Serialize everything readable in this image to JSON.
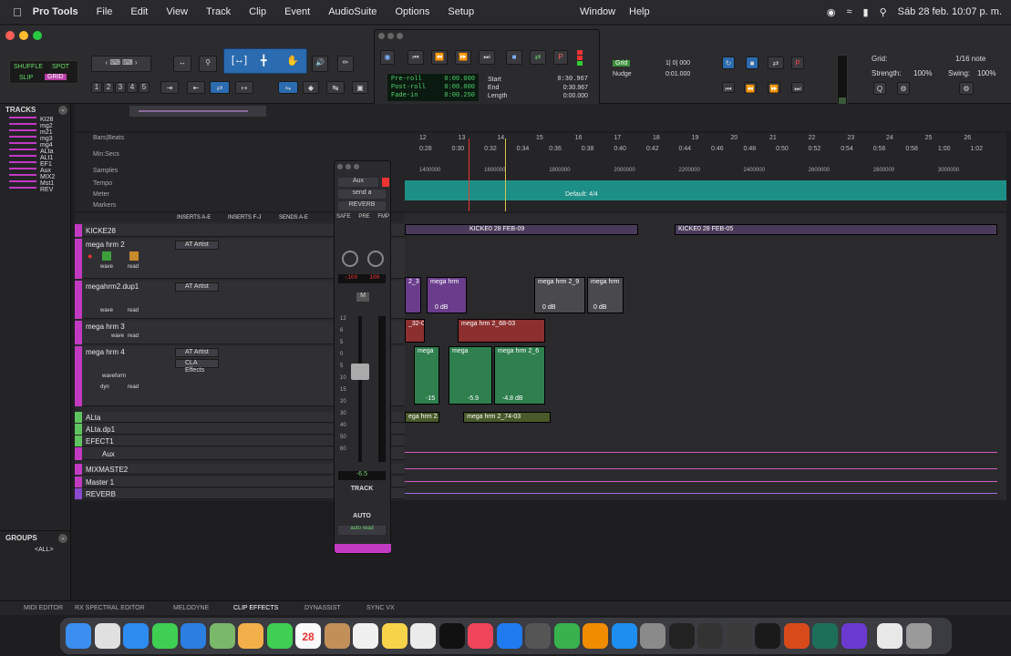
{
  "menubar": {
    "app_name": "Pro Tools",
    "menus": [
      "File",
      "Edit",
      "View",
      "Track",
      "Clip",
      "Event",
      "AudioSuite",
      "Options",
      "Setup"
    ],
    "right_menus": [
      "Window",
      "Help"
    ],
    "clock": "Sáb 28 feb.  10:07 p. m."
  },
  "edit_modes": {
    "shuffle": "SHUFFLE",
    "spot": "SPOT",
    "slip": "SLIP",
    "grid": "GRID"
  },
  "zoom_presets": [
    "1",
    "2",
    "3",
    "4",
    "5"
  ],
  "transport": {
    "preroll_label": "Pre-roll",
    "postroll_label": "Post-roll",
    "fadein_label": "Fade-in",
    "preroll": "0:00.000",
    "postroll": "0:00.000",
    "fadein": "0:00.250",
    "start_label": "Start",
    "end_label": "End",
    "length_label": "Length",
    "start": "0:30.967",
    "end": "0:30.967",
    "length": "0:00.000"
  },
  "grid_nudge": {
    "grid_label": "Grid",
    "nudge_label": "Nudge",
    "grid_value": "1| 0| 000",
    "nudge_value": "0:01.000"
  },
  "grid_settings": {
    "grid_label": "Grid:",
    "grid_value": "1/16 note",
    "strength_label": "Strength:",
    "strength_value": "100%",
    "swing_label": "Swing:",
    "swing_value": "100%"
  },
  "tracks_panel": {
    "title": "TRACKS",
    "items": [
      "KI28",
      "mg2",
      "m21",
      "mg3",
      "mg4",
      "ALta",
      "ALt1",
      "EF1",
      "Aux",
      "MIX2",
      "Mst1",
      "REV"
    ]
  },
  "groups_panel": {
    "title": "GROUPS",
    "item": "<ALL>"
  },
  "rulers": {
    "bars_beats": "Bars|Beats",
    "min_secs": "Min:Secs",
    "samples": "Samples",
    "tempo": "Tempo",
    "meter": "Meter",
    "markers": "Markers",
    "meter_value": "Default: 4/4",
    "bars": [
      "12",
      "13",
      "14",
      "15",
      "16",
      "17",
      "18",
      "19",
      "20",
      "21",
      "22",
      "23",
      "24",
      "25",
      "26"
    ],
    "secs": [
      "0:28",
      "0:30",
      "0:32",
      "0:34",
      "0:36",
      "0:38",
      "0:40",
      "0:42",
      "0:44",
      "0:46",
      "0:48",
      "0:50",
      "0:52",
      "0:54",
      "0:56",
      "0:58",
      "1:00",
      "1:02"
    ],
    "samples_values": [
      "1400000",
      "1600000",
      "1800000",
      "2000000",
      "2200000",
      "2400000",
      "2600000",
      "2800000",
      "3000000"
    ]
  },
  "column_headers": {
    "inserts_ae": "INSERTS A-E",
    "inserts_fj": "INSERTS F-J",
    "sends_ae": "SENDS A-E"
  },
  "tracks": [
    {
      "name": "KICKE28",
      "color": "#c23ac2"
    },
    {
      "name": "mega hrm 2",
      "color": "#c23ac2",
      "insert": "AT Artist",
      "mode": "wave",
      "auto": "read"
    },
    {
      "name": "megahrm2.dup1",
      "color": "#c23ac2",
      "insert": "AT Artist",
      "mode": "wave",
      "auto": "read"
    },
    {
      "name": "mega hrm 3",
      "color": "#c23ac2",
      "mode": "wave",
      "auto": "read"
    },
    {
      "name": "mega hrm 4",
      "color": "#c23ac2",
      "insert": "AT Artist",
      "insert2": "CLA Effects",
      "mode": "waveform",
      "auto": "read",
      "dyn": "dyn"
    },
    {
      "name": "ALta",
      "color": "#5fc45f"
    },
    {
      "name": "ALta.dp1",
      "color": "#5fc45f"
    },
    {
      "name": "EFECT1",
      "color": "#5fc45f"
    },
    {
      "name": "Aux",
      "color": "#c23ac2"
    },
    {
      "name": "MIXMASTE2",
      "color": "#c23ac2"
    },
    {
      "name": "Master 1",
      "color": "#c23ac2"
    },
    {
      "name": "REVERB",
      "color": "#8a4ad0"
    }
  ],
  "clips": {
    "kick_a": "KICKE0 28 FEB-09",
    "kick_b": "KICKE0 28 FEB-05",
    "hrm2_a": "2_3",
    "hrm2_b": "mega hrm",
    "hrm2_b_gain": "0 dB",
    "hrm2_c": "mega hrm 2_9",
    "hrm2_d": "mega hrm",
    "hrm2_c_gain": "0 dB",
    "hrm2_d_gain": "0 dB",
    "hrm3_a": "_32-0",
    "hrm3_b": "mega hrm 2_68-03",
    "hrm4_a": "mega",
    "hrm4_b": "mega",
    "hrm4_c": "mega hrm 2_6",
    "hrm4_a_gain": "-15",
    "hrm4_b_gain": "-5.9",
    "hrm4_c_gain": "-4.8 dB",
    "alta_a": "ega hrm 2.",
    "alta_b": "mega hrm 2_74-03"
  },
  "mixer": {
    "io": "Aux",
    "send": "send a",
    "bus": "REVERB",
    "safe": "SAFE",
    "pre": "PRE",
    "fmp": "FMP",
    "pan_left": "-100",
    "pan_right": "100",
    "vol": "-6.5",
    "track_label": "TRACK",
    "auto_label": "AUTO",
    "auto_mode": "auto read",
    "scale": [
      "12",
      "6",
      "5",
      "0",
      "5",
      "10",
      "15",
      "20",
      "30",
      "40",
      "50",
      "60"
    ]
  },
  "bottom_tabs": [
    "MIDI EDITOR",
    "RX SPECTRAL EDITOR",
    "MELODYNE",
    "CLIP EFFECTS",
    "DYNASSIST",
    "SYNC VX"
  ],
  "dock_date": "28",
  "colors": {
    "accent_blue": "#2b6bb0",
    "track_pink": "#c23ac2",
    "track_green": "#5fc45f",
    "meter_teal": "#1e8f86",
    "clip_purple": "#6a3d8c",
    "clip_red": "#8c2f2f",
    "clip_green": "#2f7f4f",
    "lcd_green": "#4fd36b"
  }
}
